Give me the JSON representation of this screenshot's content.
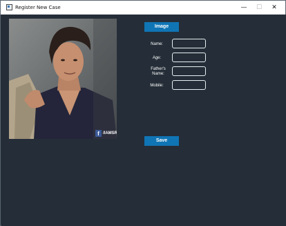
{
  "window": {
    "title": "Register New Case",
    "minimize_glyph": "—",
    "maximize_glyph": "☐",
    "close_glyph": "✕"
  },
  "photo": {
    "badge_icon": "f",
    "badge_text": "/IAMSR"
  },
  "buttons": {
    "image_label": "Image",
    "save_label": "Save"
  },
  "form": {
    "name_label": "Name:",
    "age_label": "Age:",
    "father_label_line1": "Father's",
    "father_label_line2": "Name:",
    "mobile_label": "Mobile:",
    "name_value": "",
    "age_value": "",
    "father_value": "",
    "mobile_value": ""
  },
  "colors": {
    "background": "#252e38",
    "button": "#1075b5",
    "field_border": "#e8eef2"
  }
}
